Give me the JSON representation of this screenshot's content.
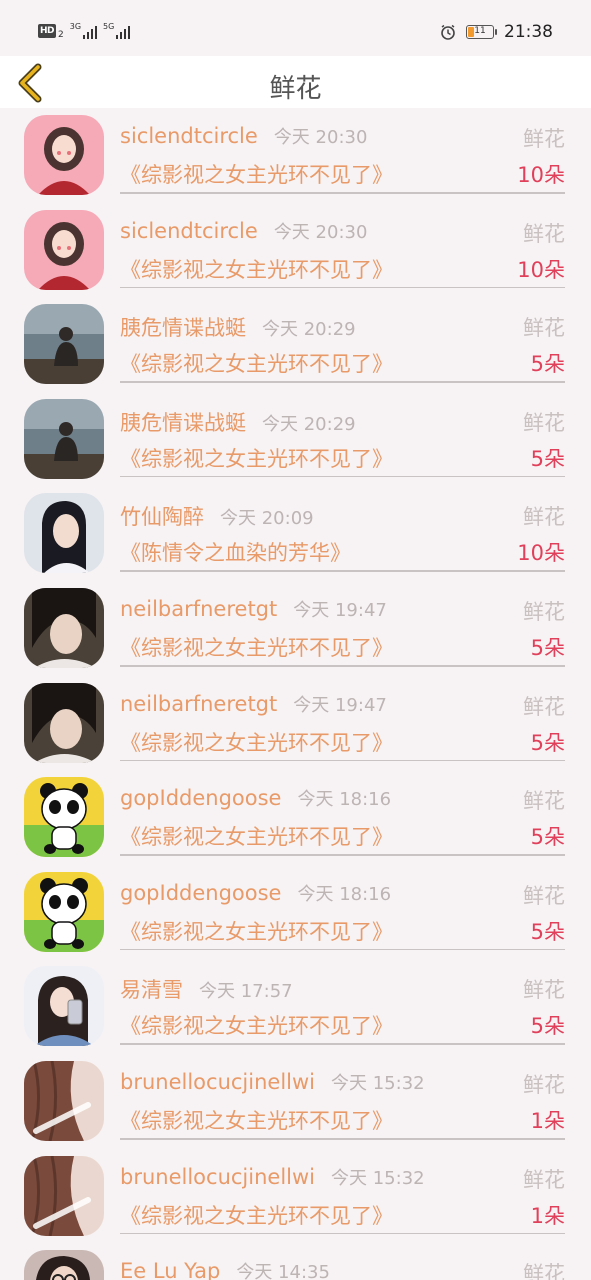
{
  "status_bar": {
    "hd": "HD",
    "hd_sub": "2",
    "net1": "3G",
    "net2": "5G",
    "battery_level": "11",
    "time": "21:38",
    "icons": [
      "alarm-icon",
      "battery-icon",
      "signal-icon"
    ]
  },
  "header": {
    "title": "鲜花",
    "back_icon": "chevron-left-icon",
    "back_color": "#e8b41e"
  },
  "colors": {
    "accent_name": "#e89a68",
    "accent_count": "#e0405a",
    "muted": "#c9c0c0"
  },
  "items": [
    {
      "username": "siclendtcircle",
      "time": "今天 20:30",
      "type": "鲜花",
      "title": "《综影视之女主光环不见了》",
      "count": "10朵",
      "avatar": "illustrated-girl"
    },
    {
      "username": "siclendtcircle",
      "time": "今天 20:30",
      "type": "鲜花",
      "title": "《综影视之女主光环不见了》",
      "count": "10朵",
      "avatar": "illustrated-girl"
    },
    {
      "username": "胰危情谍战蜓",
      "time": "今天 20:29",
      "type": "鲜花",
      "title": "《综影视之女主光环不见了》",
      "count": "5朵",
      "avatar": "person-by-sea"
    },
    {
      "username": "胰危情谍战蜓",
      "time": "今天 20:29",
      "type": "鲜花",
      "title": "《综影视之女主光环不见了》",
      "count": "5朵",
      "avatar": "person-by-sea"
    },
    {
      "username": "竹仙陶醉",
      "time": "今天 20:09",
      "type": "鲜花",
      "title": "《陈情令之血染的芳华》",
      "count": "10朵",
      "avatar": "costume-man"
    },
    {
      "username": "neilbarfneretgt",
      "time": "今天 19:47",
      "type": "鲜花",
      "title": "《综影视之女主光环不见了》",
      "count": "5朵",
      "avatar": "girl-profile"
    },
    {
      "username": "neilbarfneretgt",
      "time": "今天 19:47",
      "type": "鲜花",
      "title": "《综影视之女主光环不见了》",
      "count": "5朵",
      "avatar": "girl-profile"
    },
    {
      "username": "gopIddengoose",
      "time": "今天 18:16",
      "type": "鲜花",
      "title": "《综影视之女主光环不见了》",
      "count": "5朵",
      "avatar": "panda"
    },
    {
      "username": "gopIddengoose",
      "time": "今天 18:16",
      "type": "鲜花",
      "title": "《综影视之女主光环不见了》",
      "count": "5朵",
      "avatar": "panda"
    },
    {
      "username": "易清雪",
      "time": "今天 17:57",
      "type": "鲜花",
      "title": "《综影视之女主光环不见了》",
      "count": "5朵",
      "avatar": "mirror-selfie"
    },
    {
      "username": "brunellocucjinellwi",
      "time": "今天 15:32",
      "type": "鲜花",
      "title": "《综影视之女主光环不见了》",
      "count": "1朵",
      "avatar": "hair-text"
    },
    {
      "username": "brunellocucjinellwi",
      "time": "今天 15:32",
      "type": "鲜花",
      "title": "《综影视之女主光环不见了》",
      "count": "1朵",
      "avatar": "hair-text"
    },
    {
      "username": "Ee Lu Yap",
      "time": "今天 14:35",
      "type": "鲜花",
      "title": "",
      "count": "",
      "avatar": "glasses-person"
    }
  ]
}
